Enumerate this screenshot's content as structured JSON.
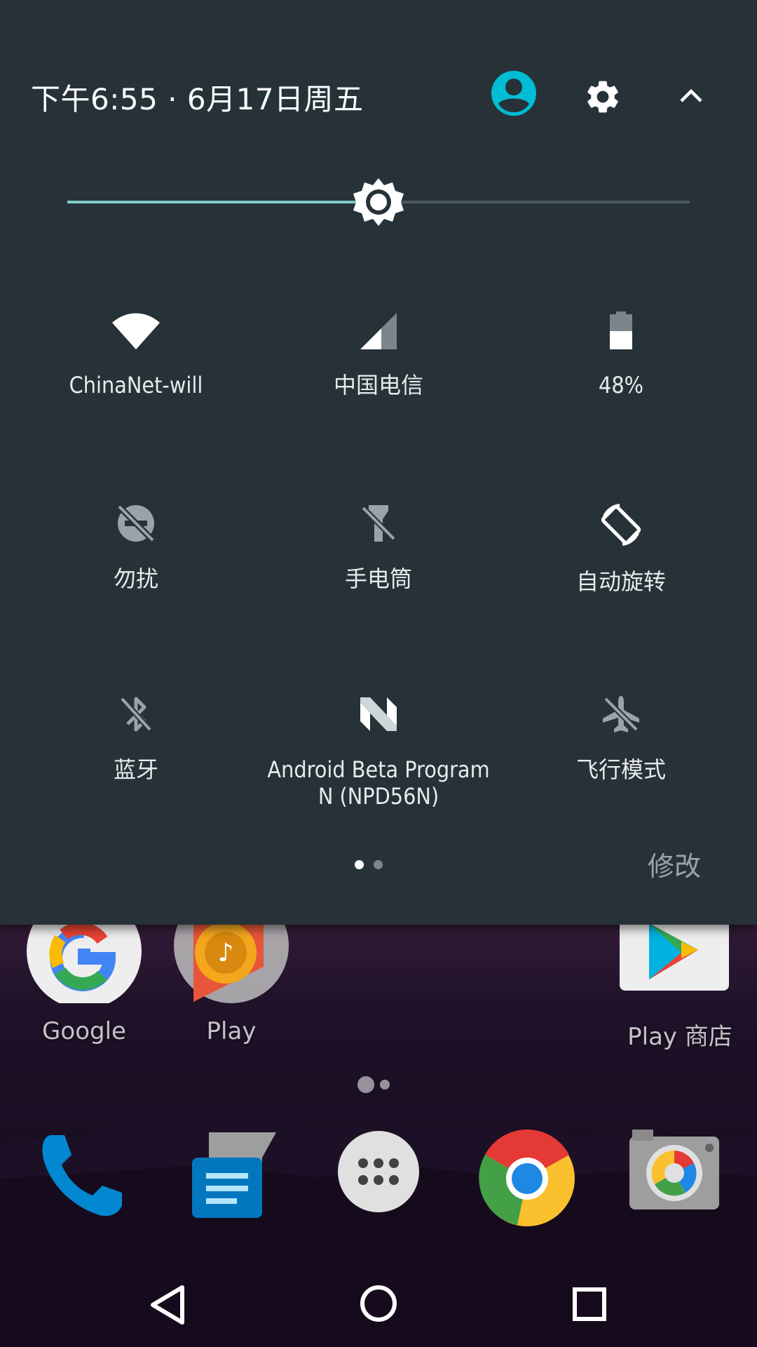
{
  "status_header": {
    "datetime": "下午6:55 · 6月17日周五"
  },
  "brightness": {
    "level_fraction": 0.5
  },
  "tiles": [
    {
      "label": "ChinaNet-will",
      "icon": "wifi-icon",
      "active": true
    },
    {
      "label": "中国电信",
      "icon": "cellular-signal-icon",
      "active": true
    },
    {
      "label": "48%",
      "icon": "battery-icon",
      "active": true
    },
    {
      "label": "勿扰",
      "icon": "do-not-disturb-off-icon",
      "active": false
    },
    {
      "label": "手电筒",
      "icon": "flashlight-off-icon",
      "active": false
    },
    {
      "label": "自动旋转",
      "icon": "auto-rotate-icon",
      "active": true
    },
    {
      "label": "蓝牙",
      "icon": "bluetooth-off-icon",
      "active": false
    },
    {
      "label": "Android Beta Program",
      "label2": "N (NPD56N)",
      "icon": "android-n-icon",
      "active": true
    },
    {
      "label": "飞行模式",
      "icon": "airplane-mode-off-icon",
      "active": false
    }
  ],
  "shade_pages": {
    "count": 2,
    "current": 1
  },
  "edit_label": "修改",
  "home": {
    "apps": [
      {
        "label": "Google",
        "icon": "google-app-icon"
      },
      {
        "label": "Play",
        "icon": "play-music-folder-icon"
      },
      {
        "label": "Play 商店",
        "icon": "play-store-icon"
      }
    ],
    "dock": [
      {
        "icon": "phone-icon"
      },
      {
        "icon": "messages-icon"
      },
      {
        "icon": "app-drawer-icon"
      },
      {
        "icon": "chrome-icon"
      },
      {
        "icon": "camera-icon"
      }
    ]
  },
  "colors": {
    "shade_bg": "#263238",
    "accent": "#80cbc4",
    "user_icon": "#00bcd4"
  }
}
